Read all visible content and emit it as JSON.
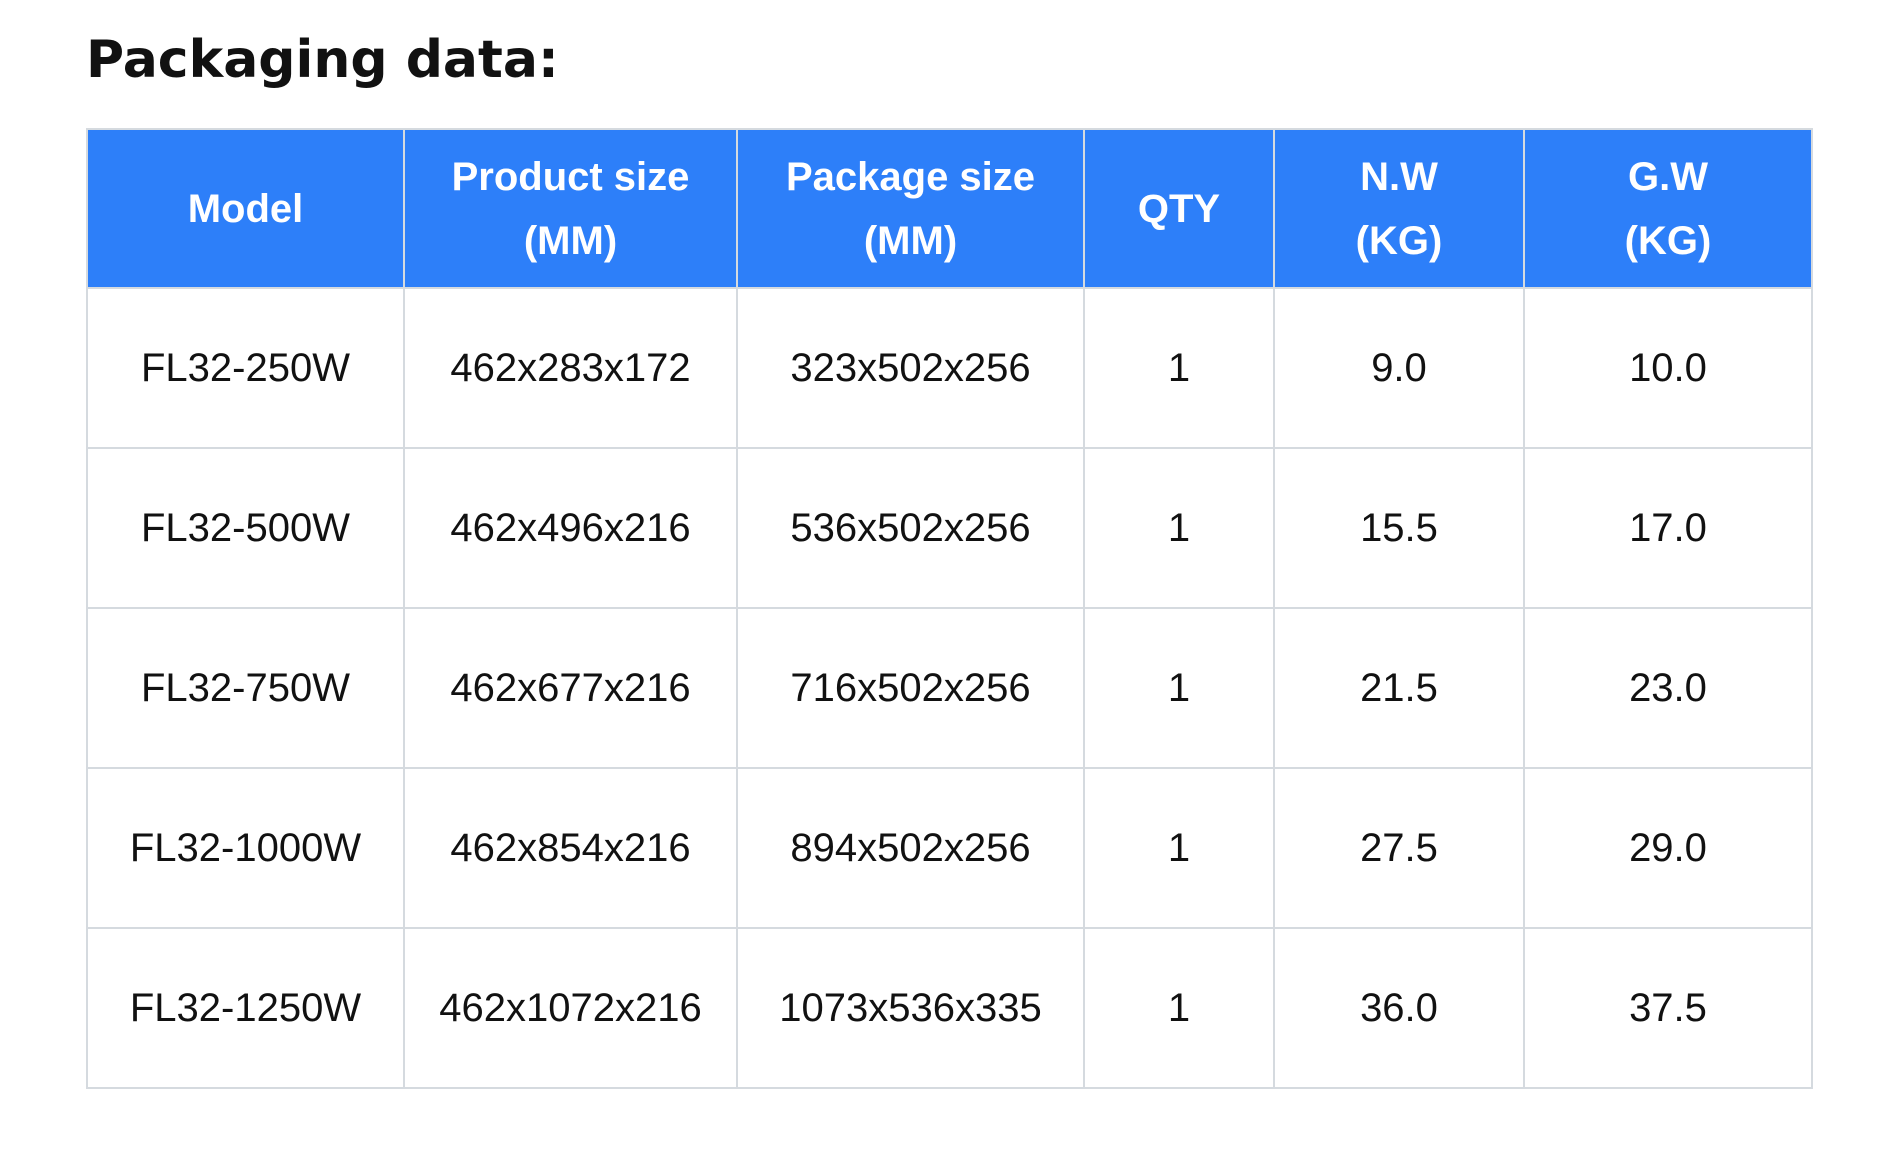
{
  "title": "Packaging data:",
  "table": {
    "headers": [
      {
        "line1": "Model",
        "line2": ""
      },
      {
        "line1": "Product size",
        "line2": "(MM)"
      },
      {
        "line1": "Package size",
        "line2": "(MM)"
      },
      {
        "line1": "QTY",
        "line2": ""
      },
      {
        "line1": "N.W",
        "line2": "(KG)"
      },
      {
        "line1": "G.W",
        "line2": "(KG)"
      }
    ],
    "rows": [
      [
        "FL32-250W",
        "462x283x172",
        "323x502x256",
        "1",
        "9.0",
        "10.0"
      ],
      [
        "FL32-500W",
        "462x496x216",
        "536x502x256",
        "1",
        "15.5",
        "17.0"
      ],
      [
        "FL32-750W",
        "462x677x216",
        "716x502x256",
        "1",
        "21.5",
        "23.0"
      ],
      [
        "FL32-1000W",
        "462x854x216",
        "894x502x256",
        "1",
        "27.5",
        "29.0"
      ],
      [
        "FL32-1250W",
        "462x1072x216",
        "1073x536x335",
        "1",
        "36.0",
        "37.5"
      ]
    ]
  },
  "colors": {
    "header_bg": "#2d7ff9",
    "header_text": "#ffffff",
    "grid": "#d5dadf",
    "body_text": "#111111"
  }
}
